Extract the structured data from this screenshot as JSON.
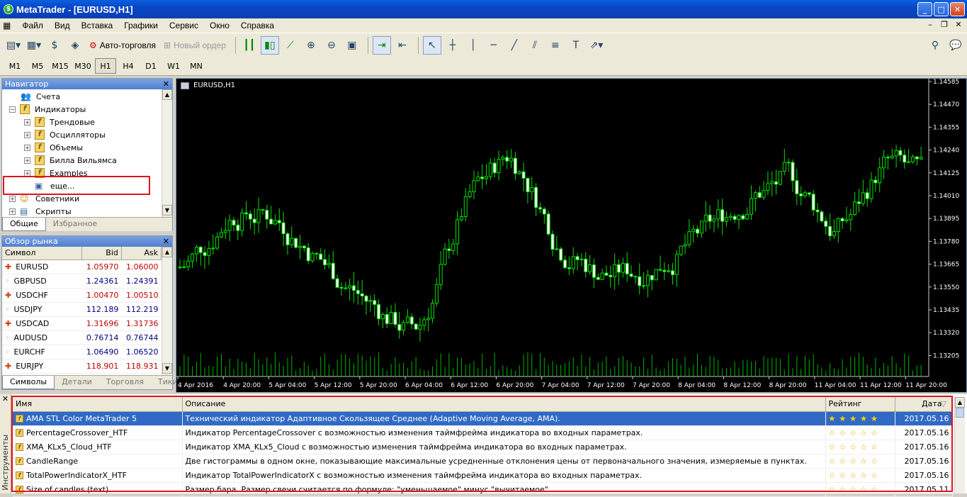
{
  "window": {
    "title": "MetaTrader - [EURUSD,H1]"
  },
  "menu": [
    "Файл",
    "Вид",
    "Вставка",
    "Графики",
    "Сервис",
    "Окно",
    "Справка"
  ],
  "toolbar": {
    "autotrade": "Авто-торговля",
    "neworder": "Новый ордер"
  },
  "timeframes": [
    "M1",
    "M5",
    "M15",
    "M30",
    "H1",
    "H4",
    "D1",
    "W1",
    "MN"
  ],
  "active_timeframe": "H1",
  "navigator": {
    "title": "Навигатор",
    "items": [
      {
        "label": "Счета",
        "level": 1
      },
      {
        "label": "Индикаторы",
        "level": 1
      },
      {
        "label": "Трендовые",
        "level": 2
      },
      {
        "label": "Осцилляторы",
        "level": 2
      },
      {
        "label": "Объемы",
        "level": 2
      },
      {
        "label": "Билла Вильямса",
        "level": 2
      },
      {
        "label": "Examples",
        "level": 2
      },
      {
        "label": "еще...",
        "level": 2
      },
      {
        "label": "Советники",
        "level": 1
      },
      {
        "label": "Скрипты",
        "level": 1
      }
    ],
    "tabs": [
      "Общие",
      "Избранное"
    ]
  },
  "market": {
    "title": "Обзор рынка",
    "headers": [
      "Символ",
      "Bid",
      "Ask"
    ],
    "rows": [
      {
        "sym": "EURUSD",
        "bid": "1.05970",
        "ask": "1.06000",
        "color": "red"
      },
      {
        "sym": "GBPUSD",
        "bid": "1.24361",
        "ask": "1.24391",
        "color": "blue"
      },
      {
        "sym": "USDCHF",
        "bid": "1.00470",
        "ask": "1.00510",
        "color": "red"
      },
      {
        "sym": "USDJPY",
        "bid": "112.189",
        "ask": "112.219",
        "color": "blue"
      },
      {
        "sym": "USDCAD",
        "bid": "1.31696",
        "ask": "1.31736",
        "color": "red"
      },
      {
        "sym": "AUDUSD",
        "bid": "0.76714",
        "ask": "0.76744",
        "color": "blue"
      },
      {
        "sym": "EURCHF",
        "bid": "1.06490",
        "ask": "1.06520",
        "color": "blue"
      },
      {
        "sym": "EURJPY",
        "bid": "118.901",
        "ask": "118.931",
        "color": "red"
      }
    ],
    "tabs": [
      "Символы",
      "Детали",
      "Торговля",
      "Тики"
    ]
  },
  "chart": {
    "label": "EURUSD,H1",
    "price_labels": [
      "1.14585",
      "1.14470",
      "1.14355",
      "1.14240",
      "1.14125",
      "1.14010",
      "1.13895",
      "1.13780",
      "1.13665",
      "1.13550",
      "1.13435",
      "1.13320",
      "1.13205"
    ],
    "time_labels": [
      "4 Apr 2016",
      "4 Apr 20:00",
      "5 Apr 04:00",
      "5 Apr 12:00",
      "5 Apr 20:00",
      "6 Apr 04:00",
      "6 Apr 12:00",
      "6 Apr 20:00",
      "7 Apr 04:00",
      "7 Apr 12:00",
      "7 Apr 20:00",
      "8 Apr 04:00",
      "8 Apr 12:00",
      "8 Apr 20:00",
      "11 Apr 04:00",
      "11 Apr 12:00",
      "11 Apr 20:00"
    ]
  },
  "toolbox": {
    "side_label": "Инструменты",
    "headers": [
      "Имя",
      "Описание",
      "Рейтинг",
      "Дата"
    ],
    "rows": [
      {
        "name": "AMA STL Color MetaTrader 5",
        "desc": "Технический индикатор Адаптивное Скользящее Среднее (Adaptive Moving Average, AMA).",
        "rating": "★★★★★",
        "date": "2017.05.16"
      },
      {
        "name": "PercentageCrossover_HTF",
        "desc": "Индикатор PercentageCrossover с возможностью изменения таймфрейма индикатора во входных параметрах.",
        "rating": "☆☆☆☆☆",
        "date": "2017.05.16"
      },
      {
        "name": "XMA_KLx5_Cloud_HTF",
        "desc": "Индикатор XMA_KLx5_Cloud с возможностью изменения таймфрейма индикатора во входных параметрах.",
        "rating": "☆☆☆☆☆",
        "date": "2017.05.16"
      },
      {
        "name": "CandleRange",
        "desc": "Две гистограммы в одном окне, показывающие максимальные усредненные отклонения цены от первоначального значения, измеряемые в пунктах.",
        "rating": "☆☆☆☆☆",
        "date": "2017.05.16"
      },
      {
        "name": "TotalPowerIndicatorX_HTF",
        "desc": "Индикатор TotalPowerIndicatorX с возможностью изменения таймфрейма индикатора во входных параметрах.",
        "rating": "☆☆☆☆☆",
        "date": "2017.05.16"
      },
      {
        "name": "Size of candles (text)",
        "desc": "Размер бара. Размер свечи считается по формуле: \"уменьшаемое\" минус \"вычитаемое\"",
        "rating": "☆☆☆☆☆",
        "date": "2017.05.11"
      }
    ]
  }
}
